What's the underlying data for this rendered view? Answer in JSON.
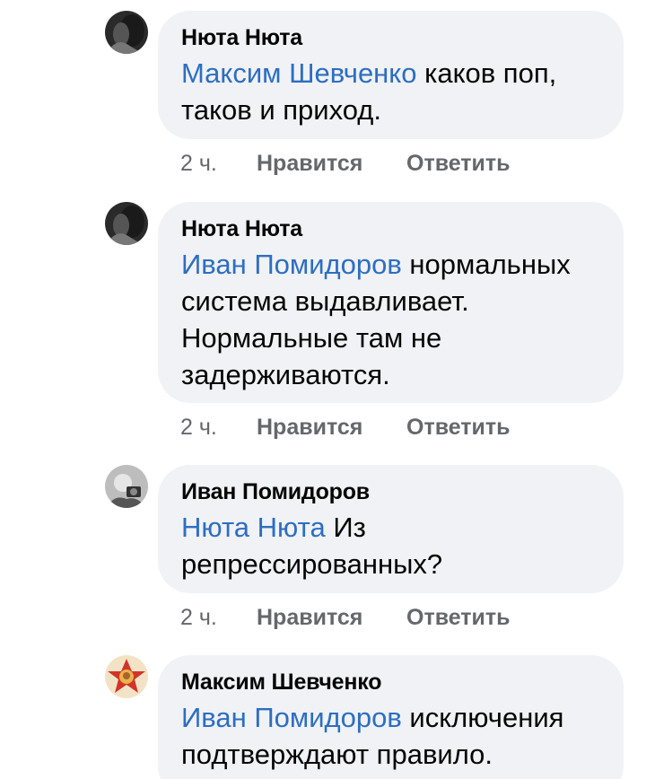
{
  "comments": [
    {
      "author": "Нюта Нюта",
      "avatar_icon": "profile-photo-dark",
      "mention": "Максим Шевченко",
      "text": " каков поп, таков и приход.",
      "time": "2 ч.",
      "like_label": "Нравится",
      "reply_label": "Ответить"
    },
    {
      "author": "Нюта Нюта",
      "avatar_icon": "profile-photo-dark",
      "mention": "Иван Помидоров",
      "text": " нормальных система выдавливает. Нормальные там не задерживаются.",
      "time": "2 ч.",
      "like_label": "Нравится",
      "reply_label": "Ответить"
    },
    {
      "author": "Иван Помидоров",
      "avatar_icon": "profile-photo-camera",
      "mention": "Нюта Нюта",
      "text": " Из репрессированных?",
      "time": "2 ч.",
      "like_label": "Нравится",
      "reply_label": "Ответить"
    },
    {
      "author": "Максим Шевченко",
      "avatar_icon": "profile-photo-badge",
      "mention": "Иван Помидоров",
      "text": " исключения подтверждают правило."
    }
  ],
  "colors": {
    "bubble": "#f0f2f5",
    "mention": "#2d6ec1",
    "meta": "#65676b",
    "text": "#050505"
  }
}
